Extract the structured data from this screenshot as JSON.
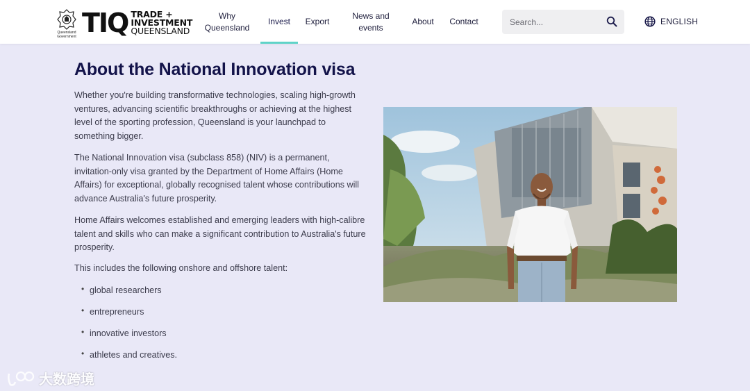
{
  "header": {
    "crest_label": "Queensland Government",
    "logo": {
      "letters": "TIQ",
      "line1": "TRADE +",
      "line2": "INVESTMENT",
      "line3": "QUEENSLAND"
    },
    "nav": [
      {
        "label": "Why Queensland"
      },
      {
        "label": "Invest"
      },
      {
        "label": "Export"
      },
      {
        "label": "News and events"
      },
      {
        "label": "About"
      },
      {
        "label": "Contact"
      }
    ],
    "active_nav": "Invest",
    "search_placeholder": "Search...",
    "language": "ENGLISH"
  },
  "main": {
    "title": "About the National Innovation visa",
    "paragraphs": [
      "Whether you're building transformative technologies, scaling high-growth ventures, advancing scientific breakthroughs or achieving at the highest level of the sporting profession, Queensland is your launchpad to something bigger.",
      "The National Innovation visa (subclass 858) (NIV) is a permanent, invitation-only visa granted by the Department of Home Affairs (Home Affairs) for exceptional, globally recognised talent whose contributions will advance Australia's future prosperity.",
      "Home Affairs welcomes established and emerging leaders with high-calibre talent and skills who can make a significant contribution to Australia's future prosperity.",
      "This includes the following onshore and offshore talent:"
    ],
    "bullets": [
      "global researchers",
      "entrepreneurs",
      "innovative investors",
      "athletes and creatives."
    ]
  },
  "watermark": {
    "text": "大数跨境"
  },
  "colors": {
    "accent": "#5fd3c8",
    "title": "#13134a",
    "background": "#e9e8f7"
  }
}
